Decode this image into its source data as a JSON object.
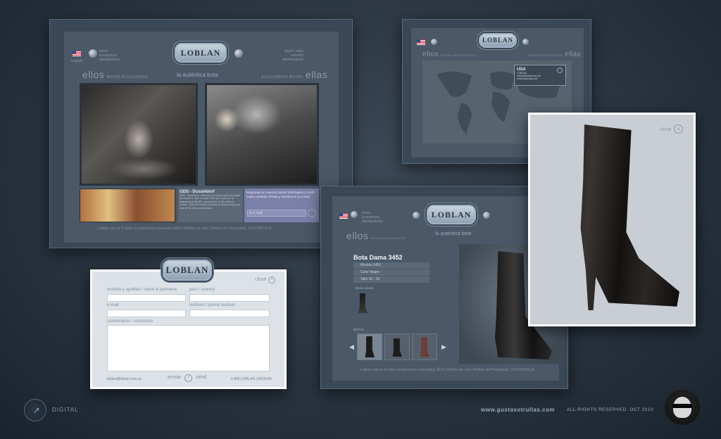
{
  "brand": {
    "logo": "LOBLAN",
    "tagline": "la auténtica bota"
  },
  "home": {
    "nav_left": [
      "home",
      "la empresa",
      "distribuidores"
    ],
    "nav_right": [
      "diseñ | ellas",
      "eventos",
      "distribuidores"
    ],
    "lang": "english",
    "cat_left_title": "ellos",
    "cat_left_sub": "BOTAS ACCESORIOS",
    "cat_right_title": "ellas",
    "cat_right_sub": "ACCESORIOS BOTAS",
    "news_title": "GDS - Dusseldorf",
    "news_body": "GDS - Dusseldorf - Alemania es la feria más importante de calzado a nivel mundial. Este año contó con la asistencia de 58.381 compradores de 85 distintos países. LOBLAN siempre presente en esta muestra por más de 15 años consecutivos.",
    "newsletter_text": "Registrate en nuestro boletín informativo y recibí todas nuestras ofertas y eventos en tu e-mail",
    "newsletter_placeholder": "tu e-mail",
    "footer": "Loblan.com.ar © todos los derechos reservados 2010 | Política de Uso | Política de Privacidad | .FOOTNOTE.A"
  },
  "map": {
    "cat_left": "ellos",
    "cat_left_sub": "BOTAS ACCESORIOS",
    "cat_right_sub": "ACCESORIOS BOTAS",
    "cat_right": "ellas",
    "popup_title": "USA",
    "popup_line1": "LOBLAN",
    "popup_line2": "loblan@loblanusa.net",
    "popup_line3": "www.loblanusa.net"
  },
  "product": {
    "nav_left": [
      "home",
      "la empresa",
      "distribuidores"
    ],
    "cat_left": "ellos",
    "cat_left_sub": "BOTAS ACCESORIOS",
    "title": "Bota Dama 3452",
    "specs": [
      "Modelo 3452",
      "Color Negro",
      "Talle 35 - 39"
    ],
    "others_label": "Otros colores",
    "carousel_label": "BOTAS",
    "footer": "Loblan.com.ar © todos los derechos reservados 2010 | Política de Uso | Política de Privacidad | .FOOTNOTE.A"
  },
  "zoom": {
    "close": "close"
  },
  "contact": {
    "close": "close",
    "label_name": "nombre y apellido / name & lastname",
    "label_country": "país / country",
    "label_email": "e-mail",
    "label_phone": "teléfono / phone number",
    "label_comments": "comentarios / comments",
    "email": "loblan@loblan.com.ar",
    "send_es": "enviar",
    "send_en": "send",
    "phone": "0-800-LOBLAN | 5625240"
  },
  "bottom": {
    "left_label": "DIGITAL",
    "site": "www.gustavotrullas.com",
    "rights": "ALL RIGHTS RESERVED. OCT 2010"
  },
  "colors": {
    "accent": "#7b80a8",
    "panel": "#3a4756"
  }
}
